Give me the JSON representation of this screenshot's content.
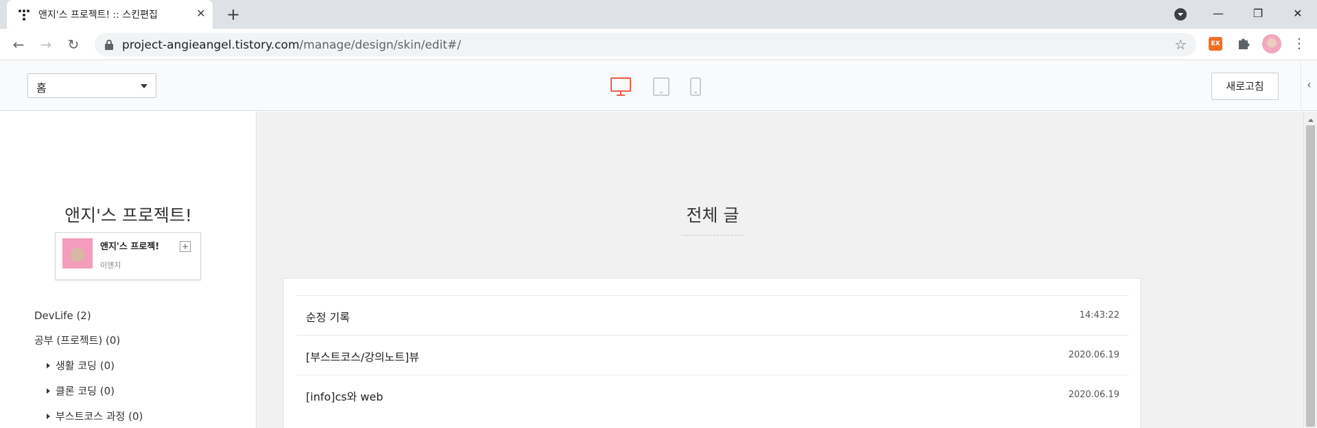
{
  "browser": {
    "tab_title": "앤지'스 프로젝트! :: 스킨편집",
    "url_domain": "project-angieangel.tistory.com",
    "url_path": "/manage/design/skin/edit#/",
    "extension_label": "EX"
  },
  "editor": {
    "page_select_value": "홈",
    "refresh_label": "새로고침",
    "device_icons": [
      "desktop-icon",
      "tablet-icon",
      "mobile-icon"
    ],
    "active_device_color": "#ee5a44"
  },
  "sidebar": {
    "blog_title": "앤지'스 프로젝트!",
    "profile": {
      "name": "앤지'스 프로젝!",
      "plus": "+",
      "owner": "이앤지"
    },
    "categories": [
      {
        "label": "DevLife (2)"
      },
      {
        "label": "공부 (프로젝트) (0)"
      },
      {
        "label": "생활 코딩 (0)"
      },
      {
        "label": "클론 코딩 (0)"
      },
      {
        "label": "부스트코스 과정 (0)"
      }
    ]
  },
  "content": {
    "heading": "전체 글",
    "posts": [
      {
        "title": "순정 기록",
        "date": "14:43:22"
      },
      {
        "title": "[부스트코스/강의노트]뷰",
        "date": "2020.06.19"
      },
      {
        "title": "[info]cs와 web",
        "date": "2020.06.19"
      }
    ]
  }
}
